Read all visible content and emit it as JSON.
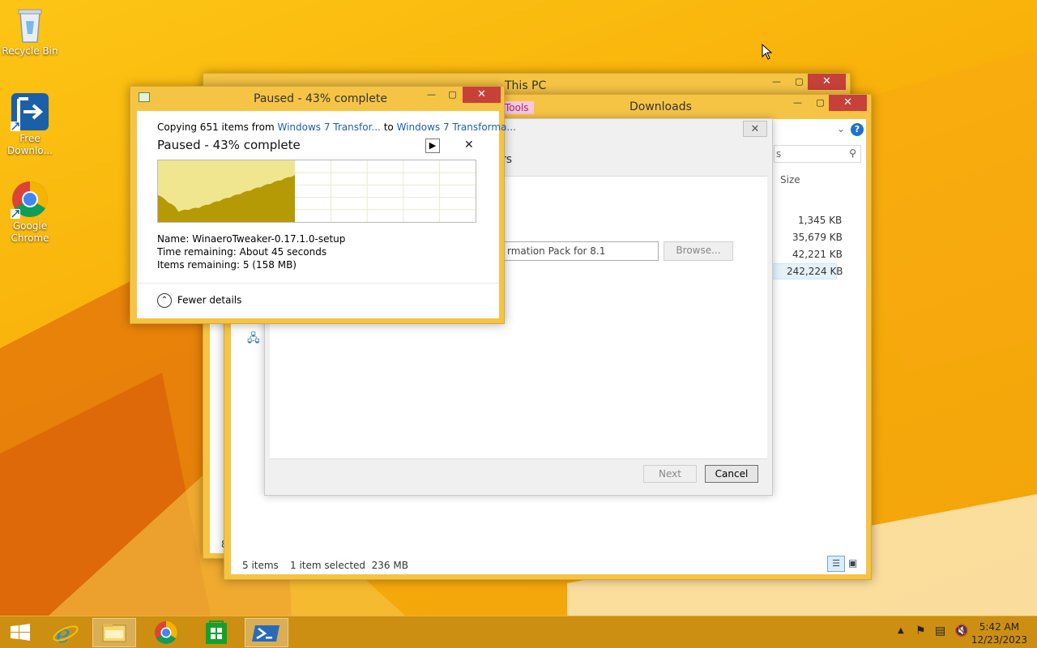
{
  "desktop": {
    "icons": [
      {
        "label": "Recycle Bin",
        "icon": "recycle-bin-icon"
      },
      {
        "label": "Free Downlo...",
        "icon": "free-download-manager-icon"
      },
      {
        "label": "Google Chrome",
        "icon": "chrome-icon"
      }
    ]
  },
  "this_pc_window": {
    "title": "This PC",
    "status_left": "8"
  },
  "downloads_window": {
    "title": "Downloads",
    "ribbon_tab": "Tools",
    "search_placeholder": "s",
    "column_size": "Size",
    "sizes": [
      "1,345 KB",
      "35,679 KB",
      "42,221 KB",
      "242,224 KB"
    ],
    "status_items": "5 items",
    "status_selected": "1 item selected  236 MB"
  },
  "wizard": {
    "heading_fragment": "rs",
    "path_value": "rmation Pack for 8.1",
    "browse_label": "Browse...",
    "next_label": "Next",
    "cancel_label": "Cancel"
  },
  "copy_dialog": {
    "title": "Paused - 43% complete",
    "copying_prefix": "Copying 651 items from",
    "source": "Windows 7 Transfor...",
    "to_word": "to",
    "destination": "Windows 7 Transforma...",
    "status": "Paused - 43% complete",
    "progress": 0.43,
    "name_label": "Name:",
    "name_value": "WinaeroTweaker-0.17.1.0-setup",
    "time_label": "Time remaining:",
    "time_value": "About 45 seconds",
    "items_label": "Items remaining:",
    "items_value": "5 (158 MB)",
    "fewer_details": "Fewer details"
  },
  "taskbar": {
    "apps": [
      "start-icon",
      "internet-explorer-icon",
      "file-explorer-icon",
      "chrome-icon",
      "store-icon",
      "powershell-icon"
    ],
    "time": "5:42 AM",
    "date": "12/23/2023"
  },
  "colors": {
    "accent": "#f6c445",
    "close_red": "#c7403a",
    "chart_fill_dark": "#b59a06",
    "chart_fill_light": "#f0e690"
  }
}
